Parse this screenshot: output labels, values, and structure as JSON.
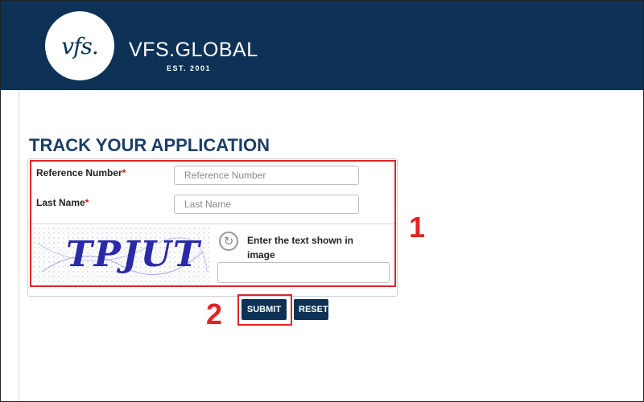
{
  "header": {
    "logo_mark": "vfs.",
    "brand": "VFS.GLOBAL",
    "est": "EST. 2001",
    "bg_color": "#0d3256"
  },
  "page": {
    "title": "TRACK YOUR APPLICATION"
  },
  "form": {
    "reference_label": "Reference Number",
    "reference_placeholder": "Reference Number",
    "reference_value": "",
    "lastname_label": "Last Name",
    "lastname_placeholder": "Last Name",
    "lastname_value": "",
    "required_mark": "*",
    "captcha_text": "TPJUT",
    "captcha_label": "Enter the text shown in image",
    "captcha_value": "",
    "refresh_icon": "refresh-icon"
  },
  "buttons": {
    "submit": "SUBMIT",
    "reset": "RESET"
  },
  "annotations": {
    "one": "1",
    "two": "2",
    "color": "#e02424"
  }
}
